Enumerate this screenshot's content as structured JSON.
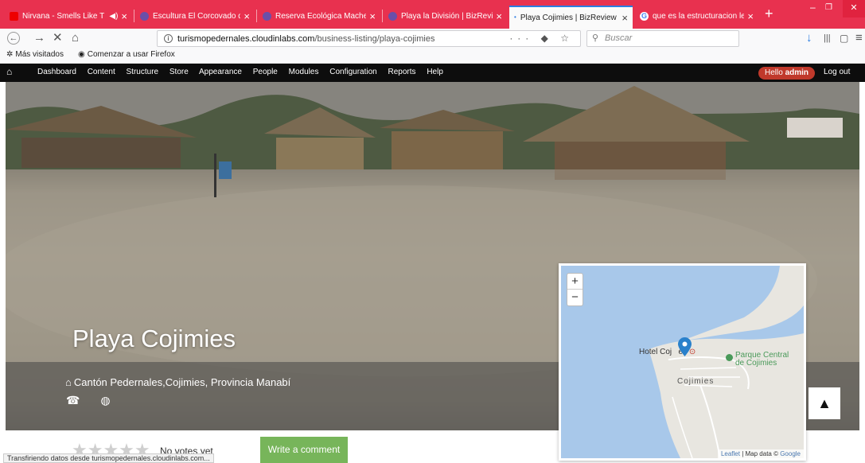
{
  "browser": {
    "tabs": [
      {
        "title": "Nirvana - Smells Like T",
        "favicon_color": "#e00",
        "audio": true
      },
      {
        "title": "Escultura El Corcovado de",
        "favicon_color": "#6b4fa8"
      },
      {
        "title": "Reserva Ecológica Mache",
        "favicon_color": "#6b4fa8"
      },
      {
        "title": "Playa la División | BizRevie",
        "favicon_color": "#6b4fa8"
      },
      {
        "title": "Playa Cojimies | BizReview",
        "favicon_color": "#2b7de1",
        "active": true
      },
      {
        "title": "que es la estructuracion le",
        "favicon_color": "#4285f4"
      }
    ],
    "url_host": "turismopedernales.cloudinlabs.com",
    "url_path": "/business-listing/playa-cojimies",
    "search_placeholder": "Buscar",
    "bookmarks": [
      "Más visitados",
      "Comenzar a usar Firefox"
    ],
    "status_text": "Transfiriendo datos desde turismopedernales.cloudinlabs.com..."
  },
  "admin_toolbar": {
    "menu": [
      "Dashboard",
      "Content",
      "Structure",
      "Store",
      "Appearance",
      "People",
      "Modules",
      "Configuration",
      "Reports",
      "Help"
    ],
    "hello_prefix": "Hello ",
    "user": "admin",
    "logout": "Log out"
  },
  "listing": {
    "title": "Playa Cojimies",
    "address": "Cantón Pedernales,Cojimies, Provincia Manabí",
    "votes_text": "No votes yet",
    "write_comment": "Write a comment"
  },
  "map": {
    "zoom_in": "+",
    "zoom_out": "−",
    "labels": {
      "hotel": "Hotel Coj",
      "hotel_suffix": "es",
      "park_line1": "Parque Central",
      "park_line2": "de Cojimies",
      "town": "Cojimies"
    },
    "attribution_leaflet": "Leaflet",
    "attribution_sep": " | Map data © ",
    "attribution_google": "Google",
    "water_color": "#a8c8ea",
    "land_color": "#e8e6e0"
  },
  "icons": {
    "back": "←",
    "forward": "→",
    "stop": "✕",
    "home": "⌂",
    "more": "···",
    "pocket": "◆",
    "star": "☆",
    "download": "↓",
    "library": "|||",
    "sidebar": "▢",
    "menu": "≡",
    "scroll_top": "▲",
    "phone": "☎",
    "globe": "◍",
    "house": "⌂"
  }
}
